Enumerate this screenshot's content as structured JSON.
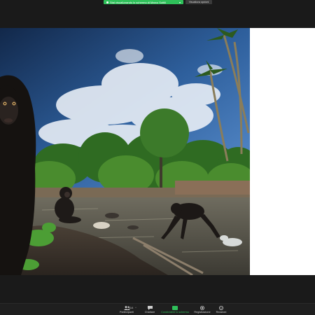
{
  "banner": {
    "sharing_text": "Stai visualizzando lo schermo di Marco Sottili",
    "options_label": "Visualizza opzioni"
  },
  "toolbar": {
    "participants_label": "Partecipanti",
    "participants_count": "114",
    "chat_label": "Chattare",
    "share_label": "Condividere lo schermo",
    "record_label": "Registrazione",
    "reactions_label": "Reazioni"
  },
  "colors": {
    "share_green": "#2fc05a",
    "toolbar_bg": "#1f1f1f",
    "frame_bg": "#1a1a1a"
  }
}
